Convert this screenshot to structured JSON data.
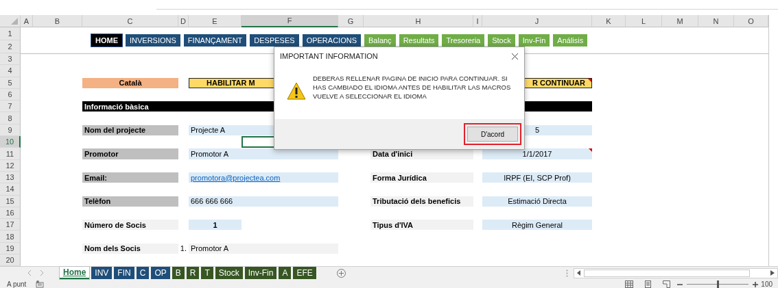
{
  "columns": [
    {
      "label": "A",
      "selected": false
    },
    {
      "label": "B",
      "selected": false
    },
    {
      "label": "C",
      "selected": false
    },
    {
      "label": "D",
      "selected": false
    },
    {
      "label": "E",
      "selected": false
    },
    {
      "label": "F",
      "selected": true
    },
    {
      "label": "G",
      "selected": false
    },
    {
      "label": "H",
      "selected": false
    },
    {
      "label": "I",
      "selected": false
    },
    {
      "label": "J",
      "selected": false
    },
    {
      "label": "K",
      "selected": false
    },
    {
      "label": "L",
      "selected": false
    },
    {
      "label": "M",
      "selected": false
    },
    {
      "label": "N",
      "selected": false
    },
    {
      "label": "O",
      "selected": false
    }
  ],
  "rows": [
    {
      "label": "1",
      "selected": false
    },
    {
      "label": "2",
      "selected": false
    },
    {
      "label": "3",
      "selected": false
    },
    {
      "label": "4",
      "selected": false
    },
    {
      "label": "5",
      "selected": false
    },
    {
      "label": "6",
      "selected": false
    },
    {
      "label": "7",
      "selected": false
    },
    {
      "label": "8",
      "selected": false
    },
    {
      "label": "9",
      "selected": false
    },
    {
      "label": "10",
      "selected": true
    },
    {
      "label": "11",
      "selected": false
    },
    {
      "label": "12",
      "selected": false
    },
    {
      "label": "13",
      "selected": false
    },
    {
      "label": "14",
      "selected": false
    },
    {
      "label": "15",
      "selected": false
    },
    {
      "label": "16",
      "selected": false
    },
    {
      "label": "17",
      "selected": false
    },
    {
      "label": "18",
      "selected": false
    },
    {
      "label": "19",
      "selected": false
    },
    {
      "label": "20",
      "selected": false
    }
  ],
  "nav_buttons": [
    {
      "label": "HOME",
      "color": "#000000"
    },
    {
      "label": "INVERSIONS",
      "color": "#1f4e79"
    },
    {
      "label": "FINANÇAMENT",
      "color": "#1f4e79"
    },
    {
      "label": "DESPESES",
      "color": "#1f4e79"
    },
    {
      "label": "OPERACIONS",
      "color": "#1f4e79"
    },
    {
      "label": "Balanç",
      "color": "#70ad47"
    },
    {
      "label": "Resultats",
      "color": "#70ad47"
    },
    {
      "label": "Tresoreria",
      "color": "#70ad47"
    },
    {
      "label": "Stock",
      "color": "#70ad47"
    },
    {
      "label": "Inv-Fin",
      "color": "#70ad47"
    },
    {
      "label": "Análisis",
      "color": "#70ad47"
    }
  ],
  "language_button": {
    "label": "Català"
  },
  "macro_banner": {
    "text_start": "HABILITAR M",
    "text_end": "R CONTINUAR",
    "has_comment": true
  },
  "section_title": "Informació bàsica",
  "form_rows": [
    {
      "label": "Nom del projecte",
      "shaded": true,
      "value": {
        "kind": "text",
        "text": "Projecte A"
      },
      "right_value": {
        "text": "5",
        "has_comment": false
      }
    },
    {
      "label": "Promotor",
      "shaded": true,
      "value": {
        "kind": "text",
        "text": "Promotor A"
      },
      "right_label": "Data d'inici",
      "right_value": {
        "text": "1/1/2017",
        "has_comment": true
      }
    },
    {
      "label": "Email:",
      "shaded": true,
      "value": {
        "kind": "link",
        "text": "promotora@projectea.com"
      },
      "right_label": "Forma Jurídica",
      "right_value": {
        "text": "IRPF (EI, SCP Prof)",
        "has_comment": false
      }
    },
    {
      "label": "Telèfon",
      "shaded": true,
      "value": {
        "kind": "text",
        "text": "666 666 666"
      },
      "right_label": "Tributació dels beneficis",
      "right_value": {
        "text": "Estimació Directa",
        "has_comment": false
      }
    },
    {
      "label": "Número de Socis",
      "shaded": false,
      "value": {
        "kind": "count",
        "text": "1"
      },
      "right_label": "Tipus d'IVA",
      "right_value": {
        "text": "Règim General",
        "has_comment": false
      }
    },
    {
      "label": "Nom dels Socis",
      "shaded": false,
      "value": {
        "kind": "numbered",
        "number": "1.",
        "text": "Promotor A"
      }
    }
  ],
  "sheet_tabs": [
    {
      "label": "Home",
      "selected": true,
      "color": "#217346"
    },
    {
      "label": "INV",
      "selected": false,
      "color": "#1f4e79"
    },
    {
      "label": "FIN",
      "selected": false,
      "color": "#1f4e79"
    },
    {
      "label": "C",
      "selected": false,
      "color": "#1f4e79"
    },
    {
      "label": "OP",
      "selected": false,
      "color": "#1f4e79"
    },
    {
      "label": "B",
      "selected": false,
      "color": "#375623"
    },
    {
      "label": "R",
      "selected": false,
      "color": "#375623"
    },
    {
      "label": "T",
      "selected": false,
      "color": "#375623"
    },
    {
      "label": "Stock",
      "selected": false,
      "color": "#375623"
    },
    {
      "label": "Inv-Fin",
      "selected": false,
      "color": "#375623"
    },
    {
      "label": "A",
      "selected": false,
      "color": "#375623"
    },
    {
      "label": "EFE",
      "selected": false,
      "color": "#375623"
    }
  ],
  "dialog": {
    "title": "IMPORTANT INFORMATION",
    "message": "DEBERAS RELLENAR PAGINA DE INICIO PARA CONTINUAR. SI HAS CAMBIADO EL IDIOMA ANTES DE HABILITAR LAS MACROS VUELVE A SELECCIONAR EL IDIOMA",
    "button": "D'acord",
    "button_highlighted": true
  },
  "status_bar": {
    "text": "A punt",
    "zoom_slider": {
      "level": 0.5
    },
    "zoom": "100"
  }
}
